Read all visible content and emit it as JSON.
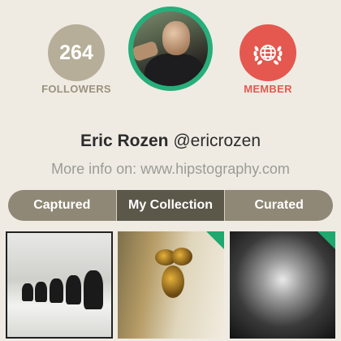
{
  "stats": {
    "followers_count": "264",
    "followers_label": "FOLLOWERS",
    "member_label": "MEMBER"
  },
  "profile": {
    "name": "Eric Rozen",
    "handle": "@ericrozen",
    "info_text": "More info on: www.hipstography.com"
  },
  "tabs": [
    {
      "label": "Captured",
      "active": false
    },
    {
      "label": "My Collection",
      "active": true
    },
    {
      "label": "Curated",
      "active": false
    }
  ],
  "icons": {
    "member": "globe-laurel-icon"
  },
  "colors": {
    "background": "#efebe3",
    "followers": "#b6ae98",
    "member": "#e4584f",
    "avatar_ring": "#27ae7a",
    "tab_bar": "#8f8876",
    "tab_active": "#5b5749",
    "corner_badge": "#1fa86f"
  }
}
